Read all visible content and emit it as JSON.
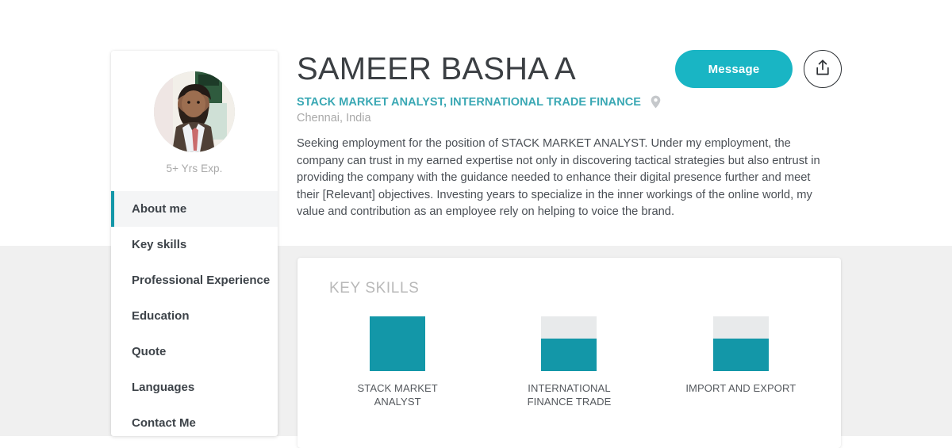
{
  "profile": {
    "name": "SAMEER BASHA A",
    "role": "STACK MARKET ANALYST, INTERNATIONAL TRADE FINANCE",
    "location": "Chennai, India",
    "experience": "5+ Yrs Exp.",
    "bio": "Seeking employment for the position of STACK MARKET ANALYST. Under my employment, the company can trust in my earned expertise not only in discovering tactical strategies but also entrust in providing the company with the guidance needed to enhance their digital presence further and meet their [Relevant] objectives. Investing years to specialize in the inner workings of the online world, my value and contribution as an employee rely on helping to voice the brand."
  },
  "actions": {
    "message_label": "Message",
    "share_icon": "share-upload-icon",
    "location_icon": "map-pin-icon"
  },
  "sidebar": {
    "avatar_icon": "profile-photo",
    "items": [
      {
        "label": "About me",
        "active": true
      },
      {
        "label": "Key skills",
        "active": false
      },
      {
        "label": "Professional Experience",
        "active": false
      },
      {
        "label": "Education",
        "active": false
      },
      {
        "label": "Quote",
        "active": false
      },
      {
        "label": "Languages",
        "active": false
      },
      {
        "label": "Contact Me",
        "active": false
      }
    ]
  },
  "skills_section": {
    "title": "KEY SKILLS"
  },
  "colors": {
    "accent_button": "#19b5c4",
    "accent_bar": "#1397a8",
    "role_text": "#3aa8b4",
    "bar_track": "#e8eaeb",
    "page_background": "#f0f0f0"
  },
  "chart_data": {
    "type": "bar",
    "title": "KEY SKILLS",
    "categories": [
      "STACK MARKET ANALYST",
      "INTERNATIONAL FINANCE TRADE",
      "IMPORT AND EXPORT"
    ],
    "values": [
      100,
      59,
      59
    ],
    "xlabel": "",
    "ylabel": "",
    "ylim": [
      0,
      100
    ],
    "grid": false,
    "legend": "none",
    "orientation": "vertical",
    "note": "Each bar is a fixed-height track filled from the bottom by the skill level percentage."
  }
}
